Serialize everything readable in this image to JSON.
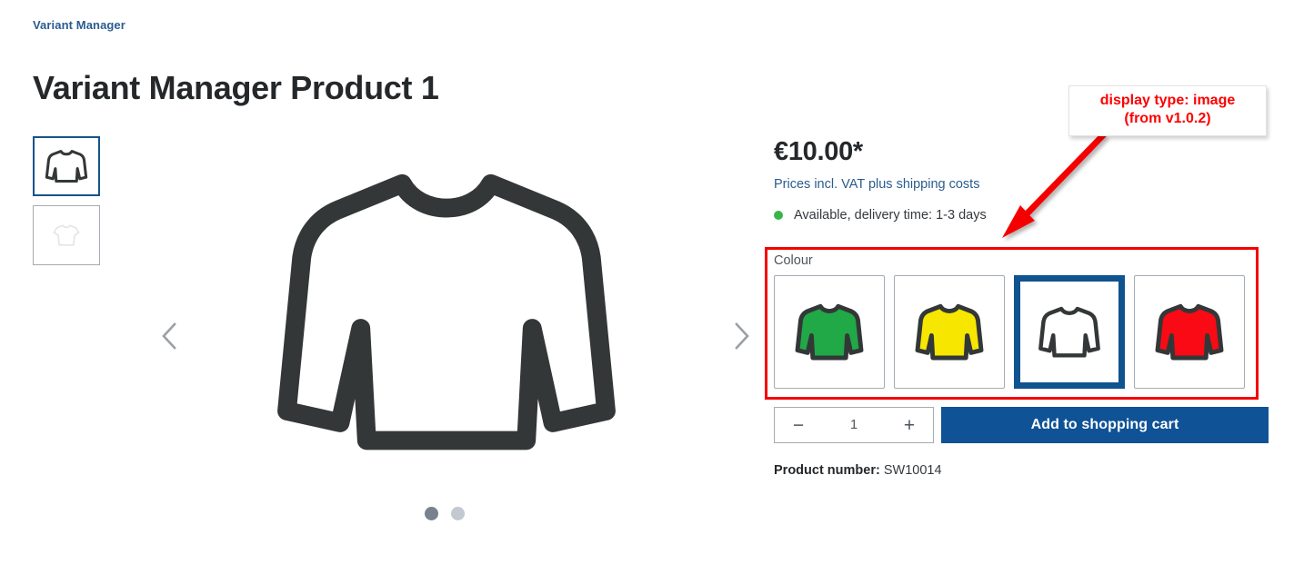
{
  "breadcrumb": "Variant Manager",
  "title": "Variant Manager Product 1",
  "gallery": {
    "thumbnails": [
      {
        "name": "longsleeve-white-thumb",
        "active": true
      },
      {
        "name": "tshirt-placeholder-thumb",
        "active": false
      }
    ],
    "prev_label": "‹",
    "next_label": "›",
    "dots": [
      {
        "active": true
      },
      {
        "active": false
      }
    ]
  },
  "buybox": {
    "price": "€10.00*",
    "tax_note": "Prices incl. VAT plus shipping costs",
    "delivery": "Available, delivery time: 1-3 days",
    "delivery_status_color": "#39b54a"
  },
  "variant": {
    "label": "Colour",
    "options": [
      {
        "name": "colour-option-green",
        "color": "#21a847",
        "selected": false
      },
      {
        "name": "colour-option-yellow",
        "color": "#f7e600",
        "selected": false
      },
      {
        "name": "colour-option-white",
        "color": "#ffffff",
        "selected": true
      },
      {
        "name": "colour-option-red",
        "color": "#fa0a14",
        "selected": false
      }
    ],
    "highlight_color": "#f50000",
    "selected_border_color": "#0f538f"
  },
  "purchase": {
    "decrease_label": "−",
    "quantity": "1",
    "increase_label": "+",
    "add_to_cart_label": "Add to shopping cart",
    "button_color": "#0f5296"
  },
  "product_number": {
    "label": "Product number:",
    "value": "SW10014"
  },
  "annotation": {
    "line1": "display type: image",
    "line2": "(from v1.0.2)",
    "color": "#fe0000"
  }
}
